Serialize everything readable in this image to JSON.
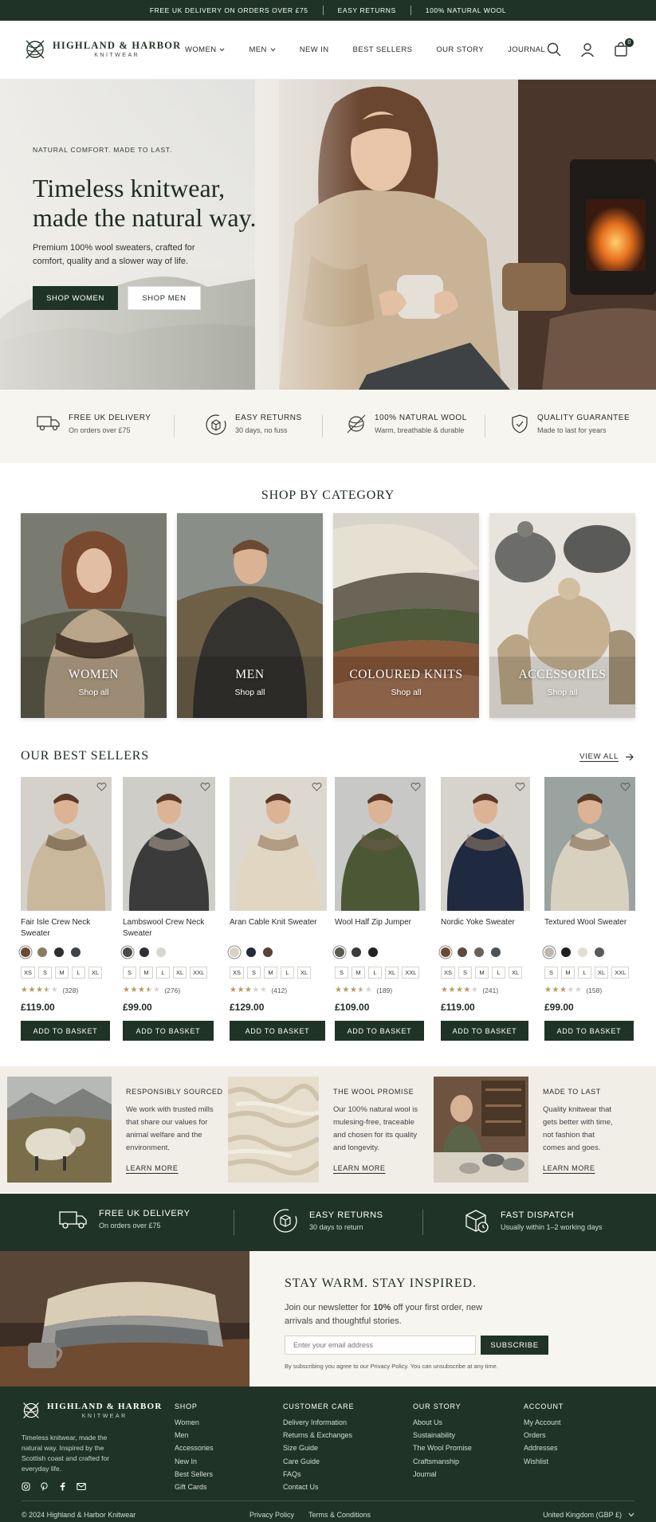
{
  "announcement": [
    "FREE UK DELIVERY ON ORDERS OVER £75",
    "EASY RETURNS",
    "100% NATURAL WOOL"
  ],
  "brand": {
    "name": "HIGHLAND & HARBOR",
    "sub": "KNITWEAR"
  },
  "nav": [
    {
      "label": "WOMEN",
      "dropdown": true
    },
    {
      "label": "MEN",
      "dropdown": true
    },
    {
      "label": "NEW IN",
      "dropdown": false
    },
    {
      "label": "BEST SELLERS",
      "dropdown": false
    },
    {
      "label": "OUR STORY",
      "dropdown": false
    },
    {
      "label": "JOURNAL",
      "dropdown": false
    }
  ],
  "cart_count": "0",
  "hero": {
    "kicker": "NATURAL COMFORT. MADE TO LAST.",
    "title_line1": "Timeless knitwear,",
    "title_line2": "made the natural way.",
    "subtitle": "Premium 100% wool sweaters, crafted for comfort, quality and a slower way of life.",
    "cta_primary": "SHOP WOMEN",
    "cta_secondary": "SHOP MEN"
  },
  "features": [
    {
      "icon": "truck-icon",
      "title": "FREE UK DELIVERY",
      "sub": "On orders over £75"
    },
    {
      "icon": "return-box-icon",
      "title": "EASY RETURNS",
      "sub": "30 days, no fuss"
    },
    {
      "icon": "yarn-ball-icon",
      "title": "100% NATURAL WOOL",
      "sub": "Warm, breathable & durable"
    },
    {
      "icon": "shield-check-icon",
      "title": "QUALITY GUARANTEE",
      "sub": "Made to last for years"
    }
  ],
  "categories_title": "SHOP BY CATEGORY",
  "categories": [
    {
      "label": "WOMEN",
      "link": "Shop all"
    },
    {
      "label": "MEN",
      "link": "Shop all"
    },
    {
      "label": "COLOURED KNITS",
      "link": "Shop all"
    },
    {
      "label": "ACCESSORIES",
      "link": "Shop all"
    }
  ],
  "best_sellers": {
    "title": "OUR BEST SELLERS",
    "view_all": "VIEW ALL",
    "button": "ADD TO BASKET",
    "products": [
      {
        "name": "Fair Isle Crew Neck Sweater",
        "colors": [
          "#6b4a33",
          "#8a7a62",
          "#2e2e2e",
          "#3e4347"
        ],
        "sizes": [
          "XS",
          "S",
          "M",
          "L",
          "XL"
        ],
        "rating": 3.5,
        "reviews": "(328)",
        "price": "£119.00"
      },
      {
        "name": "Lambswool Crew Neck Sweater",
        "colors": [
          "#4a4a48",
          "#2e3036",
          "#d9d6cf"
        ],
        "sizes": [
          "S",
          "M",
          "L",
          "XL",
          "XXL"
        ],
        "rating": 3.5,
        "reviews": "(276)",
        "price": "£99.00"
      },
      {
        "name": "Aran Cable Knit Sweater",
        "colors": [
          "#d8d2c2",
          "#252a3a",
          "#5a4234"
        ],
        "sizes": [
          "XS",
          "S",
          "M",
          "L",
          "XL"
        ],
        "rating": 3,
        "reviews": "(412)",
        "price": "£129.00"
      },
      {
        "name": "Wool Half Zip Jumper",
        "colors": [
          "#5a5a50",
          "#3a3a3a",
          "#222222"
        ],
        "sizes": [
          "S",
          "M",
          "L",
          "XL",
          "XXL"
        ],
        "rating": 3.5,
        "reviews": "(189)",
        "price": "£109.00"
      },
      {
        "name": "Nordic Yoke Sweater",
        "colors": [
          "#6b4a33",
          "#5c4a3c",
          "#66625a",
          "#4c5358"
        ],
        "sizes": [
          "XS",
          "S",
          "M",
          "L",
          "XL"
        ],
        "rating": 4,
        "reviews": "(241)",
        "price": "£119.00"
      },
      {
        "name": "Textured Wool Sweater",
        "colors": [
          "#bdb8ae",
          "#1f1f1f",
          "#e2ded6",
          "#5a5a58"
        ],
        "sizes": [
          "S",
          "M",
          "L",
          "XL",
          "XXL"
        ],
        "rating": 3,
        "reviews": "(158)",
        "price": "£99.00"
      }
    ]
  },
  "story": [
    {
      "title": "RESPONSIBLY SOURCED",
      "body": "We work with trusted mills that share our values for animal welfare and the environment.",
      "link": "LEARN MORE"
    },
    {
      "title": "THE WOOL PROMISE",
      "body": "Our 100% natural wool is mulesing-free, traceable and chosen for its quality and longevity.",
      "link": "LEARN MORE"
    },
    {
      "title": "MADE TO LAST",
      "body": "Quality knitwear that gets better with time, not fashion that comes and goes.",
      "link": "LEARN MORE"
    }
  ],
  "service": [
    {
      "icon": "truck-icon",
      "title": "FREE UK DELIVERY",
      "sub": "On orders over £75"
    },
    {
      "icon": "return-box-icon",
      "title": "EASY RETURNS",
      "sub": "30 days to return"
    },
    {
      "icon": "fast-dispatch-icon",
      "title": "FAST DISPATCH",
      "sub": "Usually within 1–2 working days"
    }
  ],
  "newsletter": {
    "title": "STAY WARM. STAY INSPIRED.",
    "text_before": "Join our newsletter for ",
    "text_bold": "10%",
    "text_after": " off your first order, new arrivals and thoughtful stories.",
    "placeholder": "Enter your email address",
    "button": "SUBSCRIBE",
    "note": "By subscribing you agree to our Privacy Policy. You can unsubscribe at any time."
  },
  "footer": {
    "description": "Timeless knitwear, made the natural way. Inspired by the Scottish coast and crafted for everyday life.",
    "columns": [
      {
        "title": "SHOP",
        "links": [
          "Women",
          "Men",
          "Accessories",
          "New In",
          "Best Sellers",
          "Gift Cards"
        ]
      },
      {
        "title": "CUSTOMER CARE",
        "links": [
          "Delivery Information",
          "Returns & Exchanges",
          "Size Guide",
          "Care Guide",
          "FAQs",
          "Contact Us"
        ]
      },
      {
        "title": "OUR STORY",
        "links": [
          "About Us",
          "Sustainability",
          "The Wool Promise",
          "Craftsmanship",
          "Journal"
        ]
      },
      {
        "title": "ACCOUNT",
        "links": [
          "My Account",
          "Orders",
          "Addresses",
          "Wishlist"
        ]
      }
    ],
    "social": [
      "instagram-icon",
      "pinterest-icon",
      "facebook-icon",
      "mail-icon"
    ],
    "copyright": "© 2024 Highland & Harbor Knitwear",
    "legal": [
      "Privacy Policy",
      "Terms & Conditions"
    ],
    "region": "United Kingdom (GBP £)"
  },
  "colors": {
    "brand_green": "#1f3426",
    "cream": "#f7f5f0",
    "star": "#b89a5c"
  }
}
